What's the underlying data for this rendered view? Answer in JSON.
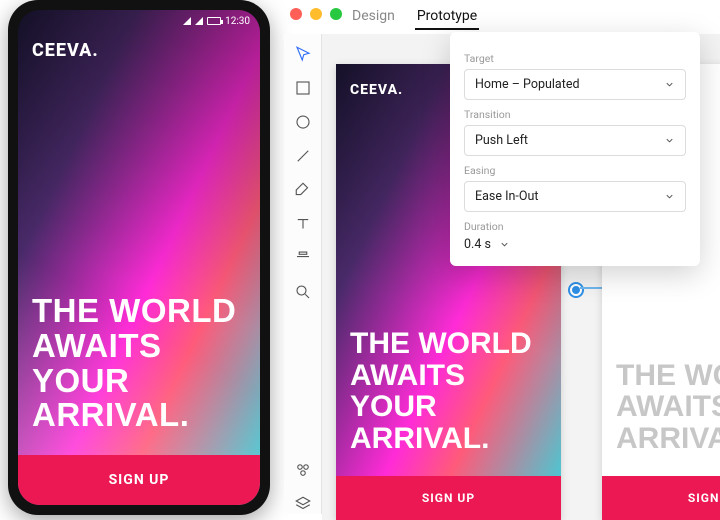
{
  "device": {
    "status_time": "12:30",
    "brand": "CEEVA.",
    "headline": "THE WORLD AWAITS YOUR ARRIVAL.",
    "cta_label": "SIGN UP"
  },
  "window": {
    "tabs": {
      "design": "Design",
      "prototype": "Prototype"
    }
  },
  "artboards": {
    "primary": {
      "brand": "CEEVA.",
      "headline": "THE WORLD AWAITS YOUR ARRIVAL.",
      "cta_label": "SIGN UP"
    },
    "secondary": {
      "headline": "THE WOR\nAWAITS Y\nARRIVAL.",
      "cta_label": "SIGN UP"
    }
  },
  "popover": {
    "target_label": "Target",
    "target_value": "Home – Populated",
    "transition_label": "Transition",
    "transition_value": "Push Left",
    "easing_label": "Easing",
    "easing_value": "Ease In-Out",
    "duration_label": "Duration",
    "duration_value": "0.4 s"
  }
}
